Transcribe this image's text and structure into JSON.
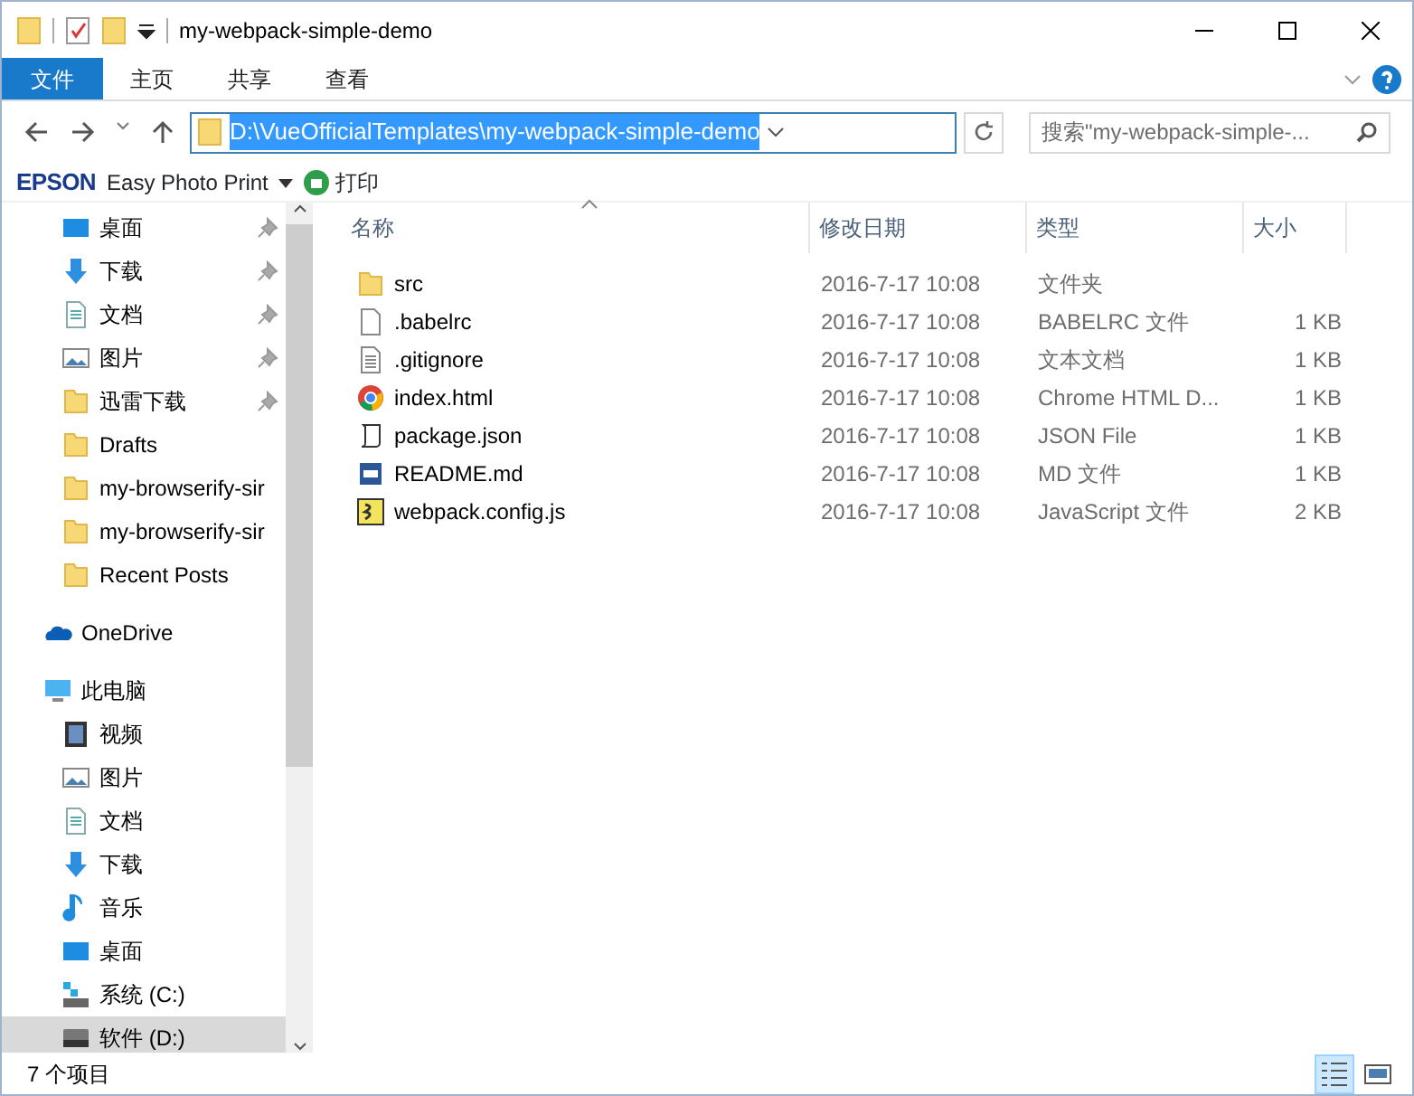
{
  "window": {
    "title": "my-webpack-simple-demo"
  },
  "ribbon_tabs": [
    {
      "label": "文件",
      "selected": true
    },
    {
      "label": "主页",
      "selected": false
    },
    {
      "label": "共享",
      "selected": false
    },
    {
      "label": "查看",
      "selected": false
    }
  ],
  "address": {
    "path": "D:\\VueOfficialTemplates\\my-webpack-simple-demo",
    "selected": true
  },
  "search": {
    "placeholder": "搜索\"my-webpack-simple-..."
  },
  "toolbar": {
    "brand": "EPSON",
    "app": "Easy Photo Print",
    "print": "打印"
  },
  "quick_access_items": [
    {
      "label": "桌面",
      "kind": "desktop",
      "pinned": true,
      "selected": false
    },
    {
      "label": "下载",
      "kind": "download",
      "pinned": true,
      "selected": false
    },
    {
      "label": "文档",
      "kind": "document",
      "pinned": true,
      "selected": false
    },
    {
      "label": "图片",
      "kind": "pictures",
      "pinned": true,
      "selected": false
    },
    {
      "label": "迅雷下载",
      "kind": "folder",
      "pinned": true,
      "selected": false
    },
    {
      "label": "Drafts",
      "kind": "folder",
      "pinned": false,
      "selected": false
    },
    {
      "label": "my-browserify-sir",
      "kind": "folder",
      "pinned": false,
      "selected": false
    },
    {
      "label": "my-browserify-sir",
      "kind": "folder",
      "pinned": false,
      "selected": false
    },
    {
      "label": "Recent Posts",
      "kind": "folder",
      "pinned": false,
      "selected": false
    }
  ],
  "nav_roots": [
    {
      "label": "OneDrive",
      "kind": "cloud",
      "selected": false
    },
    {
      "label": "此电脑",
      "kind": "computer",
      "selected": false,
      "children": [
        {
          "label": "视频",
          "kind": "video",
          "selected": false
        },
        {
          "label": "图片",
          "kind": "pictures",
          "selected": false
        },
        {
          "label": "文档",
          "kind": "document",
          "selected": false
        },
        {
          "label": "下载",
          "kind": "download",
          "selected": false
        },
        {
          "label": "音乐",
          "kind": "music",
          "selected": false
        },
        {
          "label": "桌面",
          "kind": "desktop",
          "selected": false
        },
        {
          "label": "系统 (C:)",
          "kind": "system-drive",
          "selected": false
        },
        {
          "label": "软件 (D:)",
          "kind": "drive",
          "selected": true
        }
      ]
    }
  ],
  "columns": [
    {
      "label": "名称",
      "sorted": true
    },
    {
      "label": "修改日期",
      "sorted": false
    },
    {
      "label": "类型",
      "sorted": false
    },
    {
      "label": "大小",
      "sorted": false
    }
  ],
  "files": [
    {
      "name": "src",
      "kind": "folder",
      "modified": "2016-7-17 10:08",
      "type": "文件夹"
    },
    {
      "name": ".babelrc",
      "kind": "blank",
      "modified": "2016-7-17 10:08",
      "type": "BABELRC 文件",
      "size": "1 KB"
    },
    {
      "name": ".gitignore",
      "kind": "text",
      "modified": "2016-7-17 10:08",
      "type": "文本文档",
      "size": "1 KB"
    },
    {
      "name": "index.html",
      "kind": "chrome",
      "modified": "2016-7-17 10:08",
      "type": "Chrome HTML D...",
      "size": "1 KB"
    },
    {
      "name": "package.json",
      "kind": "script",
      "modified": "2016-7-17 10:08",
      "type": "JSON File",
      "size": "1 KB"
    },
    {
      "name": "README.md",
      "kind": "markdown",
      "modified": "2016-7-17 10:08",
      "type": "MD 文件",
      "size": "1 KB"
    },
    {
      "name": "webpack.config.js",
      "kind": "js",
      "modified": "2016-7-17 10:08",
      "type": "JavaScript 文件",
      "size": "2 KB"
    }
  ],
  "status_bar": {
    "count": "7 个项目",
    "view_modes": [
      {
        "kind": "details",
        "selected": true
      },
      {
        "kind": "large-icons",
        "selected": false
      }
    ]
  }
}
